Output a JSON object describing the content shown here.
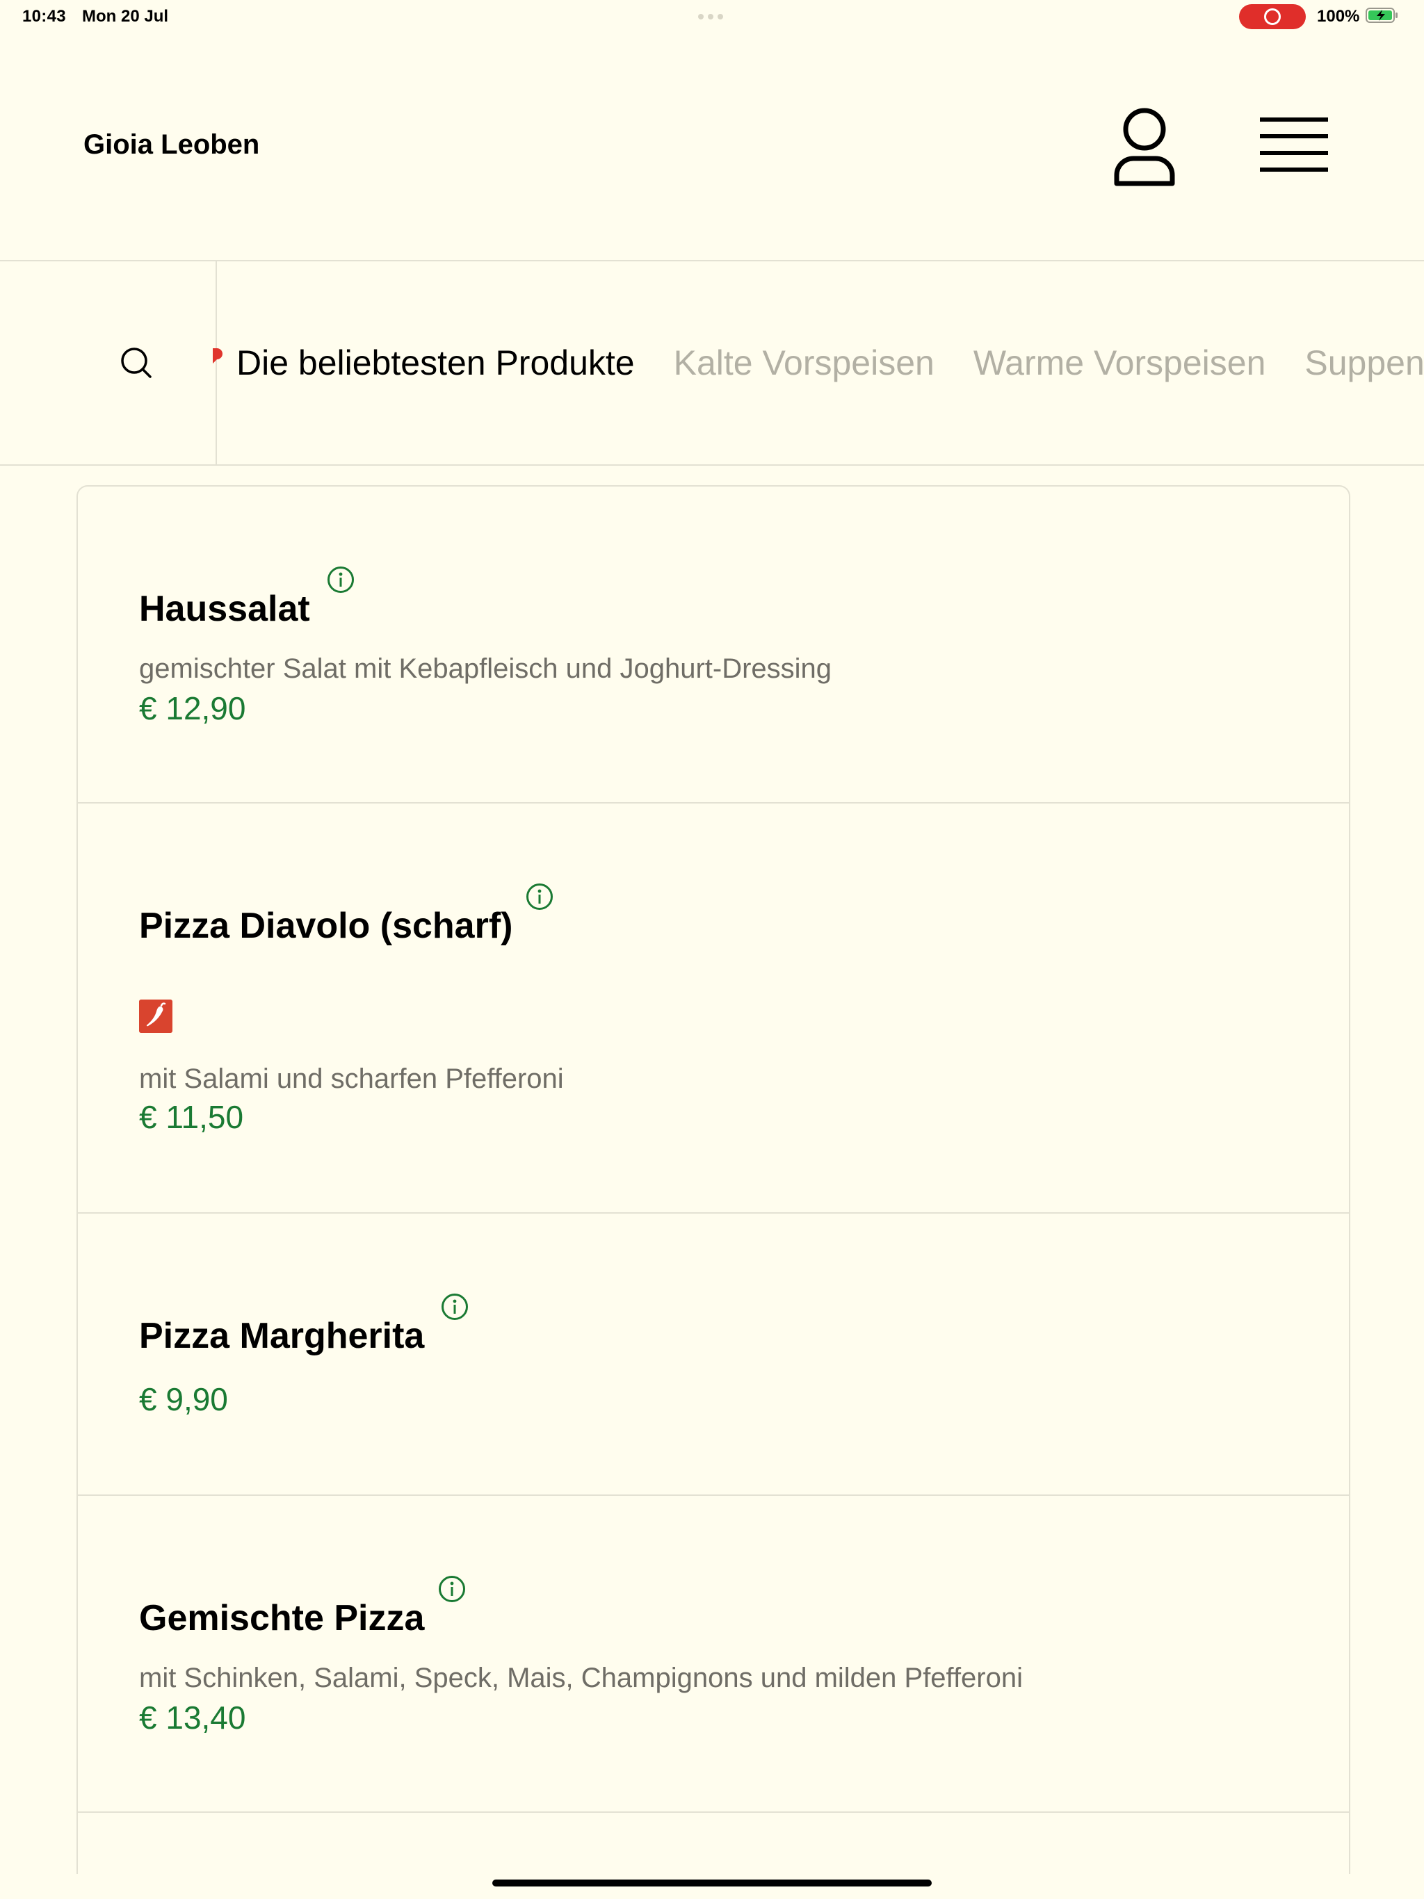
{
  "status_bar": {
    "time": "10:43",
    "date": "Mon 20 Jul",
    "battery_pct": "100%"
  },
  "header": {
    "brand": "Gioia Leoben"
  },
  "categories": [
    {
      "label": "Die beliebtesten Produkte",
      "active": true
    },
    {
      "label": "Kalte Vorspeisen",
      "active": false
    },
    {
      "label": "Warme Vorspeisen",
      "active": false
    },
    {
      "label": "Suppen",
      "active": false
    }
  ],
  "products": [
    {
      "name": "Haussalat",
      "description": "gemischter Salat mit Kebapfleisch und Joghurt-Dressing",
      "price": "€ 12,90"
    },
    {
      "name": "Pizza Diavolo (scharf)",
      "description": "mit Salami und scharfen Pfefferoni",
      "price": "€ 11,50",
      "badge": "spicy-icon"
    },
    {
      "name": "Pizza Margherita",
      "description": "",
      "price": "€ 9,90"
    },
    {
      "name": "Gemischte Pizza",
      "description": "mit Schinken, Salami, Speck, Mais, Champignons und milden Pfefferoni",
      "price": "€ 13,40"
    }
  ],
  "colors": {
    "background": "#fffdee",
    "price": "#1a7a33",
    "accent_red": "#d9442e",
    "muted_text": "#6f6d66",
    "inactive_category": "#b2b0a4"
  }
}
